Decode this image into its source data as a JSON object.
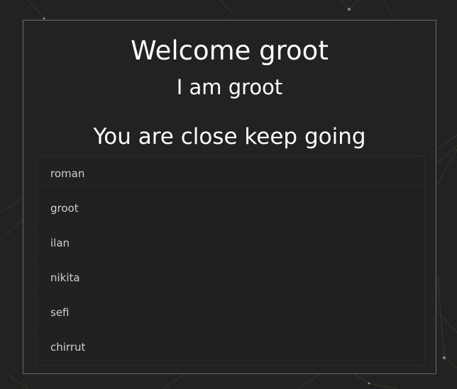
{
  "header": {
    "title": "Welcome groot",
    "subtitle": "I am groot",
    "message": "You are close keep going"
  },
  "names": [
    {
      "label": "roman"
    },
    {
      "label": "groot"
    },
    {
      "label": "ilan"
    },
    {
      "label": "nikita"
    },
    {
      "label": "sefi"
    },
    {
      "label": "chirrut"
    }
  ],
  "colors": {
    "background": "#222222",
    "panel_border": "#6a6a6a",
    "heading_text": "#ffffff",
    "list_text": "#cfcfcf",
    "network_lines": "#5a4a1e"
  }
}
